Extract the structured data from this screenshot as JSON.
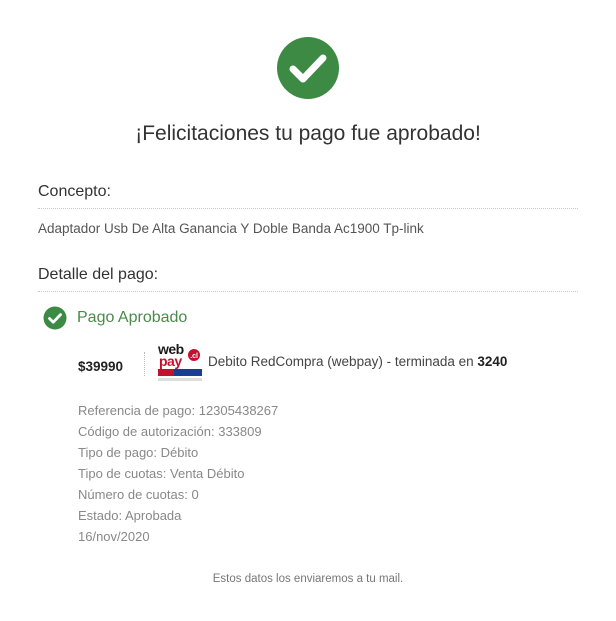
{
  "hero": {
    "icon": "check-circle-icon",
    "color": "#3d8a45"
  },
  "title": "¡Felicitaciones tu pago fue aprobado!",
  "concept": {
    "label": "Concepto:",
    "value": "Adaptador Usb De Alta Ganancia Y Doble Banda Ac1900 Tp-link"
  },
  "payment_detail": {
    "label": "Detalle del pago:",
    "status": {
      "icon": "check-circle-icon",
      "text": "Pago Aprobado",
      "color": "#3d8a45"
    },
    "amount": "$39990",
    "method": {
      "logo": "webpay-plus-logo",
      "logo_text": "webpay",
      "description_prefix": "Debito RedCompra (webpay) - terminada en",
      "last_digits": "3240"
    },
    "rows": [
      {
        "label": "Referencia de pago:",
        "value": "12305438267"
      },
      {
        "label": "Código de autorización:",
        "value": "333809"
      },
      {
        "label": "Tipo de pago:",
        "value": "Débito"
      },
      {
        "label": "Tipo de cuotas:",
        "value": "Venta Débito"
      },
      {
        "label": "Número de cuotas:",
        "value": "0"
      },
      {
        "label": "Estado:",
        "value": "Aprobada"
      },
      {
        "label": "",
        "value": "16/nov/2020"
      }
    ]
  },
  "footer": "Estos datos los enviaremos a tu mail."
}
